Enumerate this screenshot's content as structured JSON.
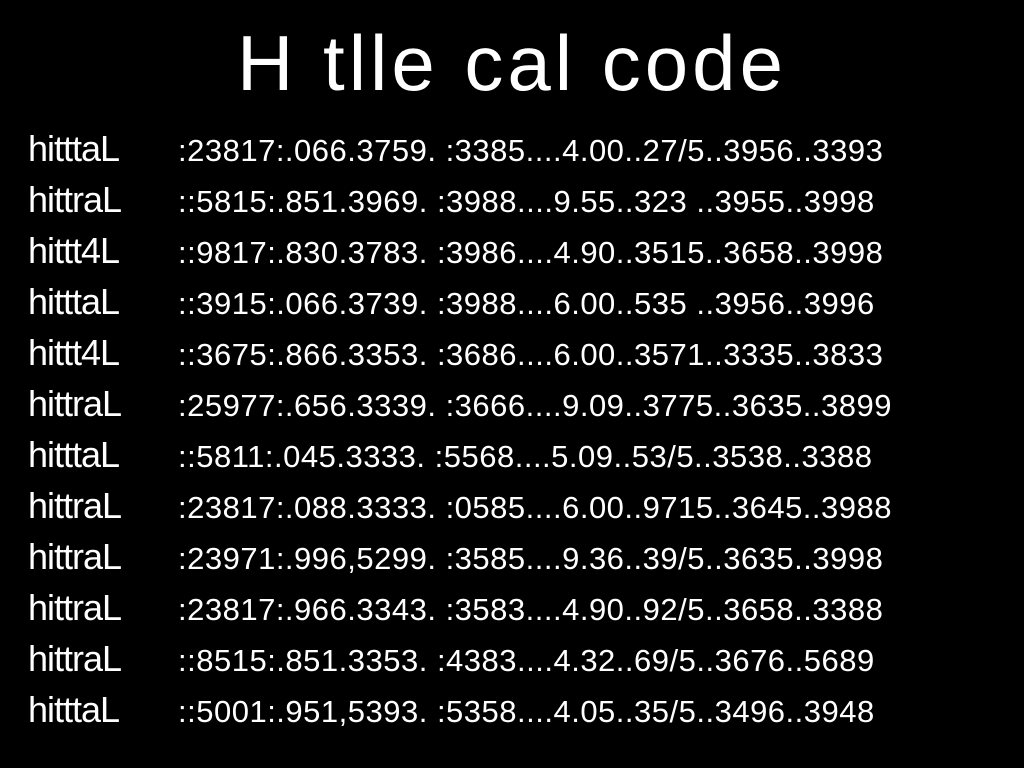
{
  "title": "H tlle cal code",
  "rows": [
    {
      "label": "hitttaL",
      "codes": ":23817:.066.3759. :3385....4.00..27/5..3956..3393"
    },
    {
      "label": "hittraL",
      "codes": "::5815:.851.3969. :3988....9.55..323 ..3955..3998"
    },
    {
      "label": "hittt4L",
      "codes": "::9817:.830.3783. :3986....4.90..3515..3658..3998"
    },
    {
      "label": "hitttaL",
      "codes": "::3915:.066.3739. :3988....6.00..535 ..3956..3996"
    },
    {
      "label": "hittt4L",
      "codes": "::3675:.866.3353. :3686....6.00..3571..3335..3833"
    },
    {
      "label": "hittraL",
      "codes": ":25977:.656.3339. :3666....9.09..3775..3635..3899"
    },
    {
      "label": "hitttaL",
      "codes": "::5811:.045.3333. :5568....5.09..53/5..3538..3388"
    },
    {
      "label": "hittraL",
      "codes": ":23817:.088.3333. :0585....6.00..9715..3645..3988"
    },
    {
      "label": "hittraL",
      "codes": ":23971:.996,5299. :3585....9.36..39/5..3635..3998"
    },
    {
      "label": "hittraL",
      "codes": ":23817:.966.3343. :3583....4.90..92/5..3658..3388"
    },
    {
      "label": "hittraL",
      "codes": "::8515:.851.3353. :4383....4.32..69/5..3676..5689"
    },
    {
      "label": "hitttaL",
      "codes": "::5001:.951,5393. :5358....4.05..35/5..3496..3948"
    }
  ]
}
